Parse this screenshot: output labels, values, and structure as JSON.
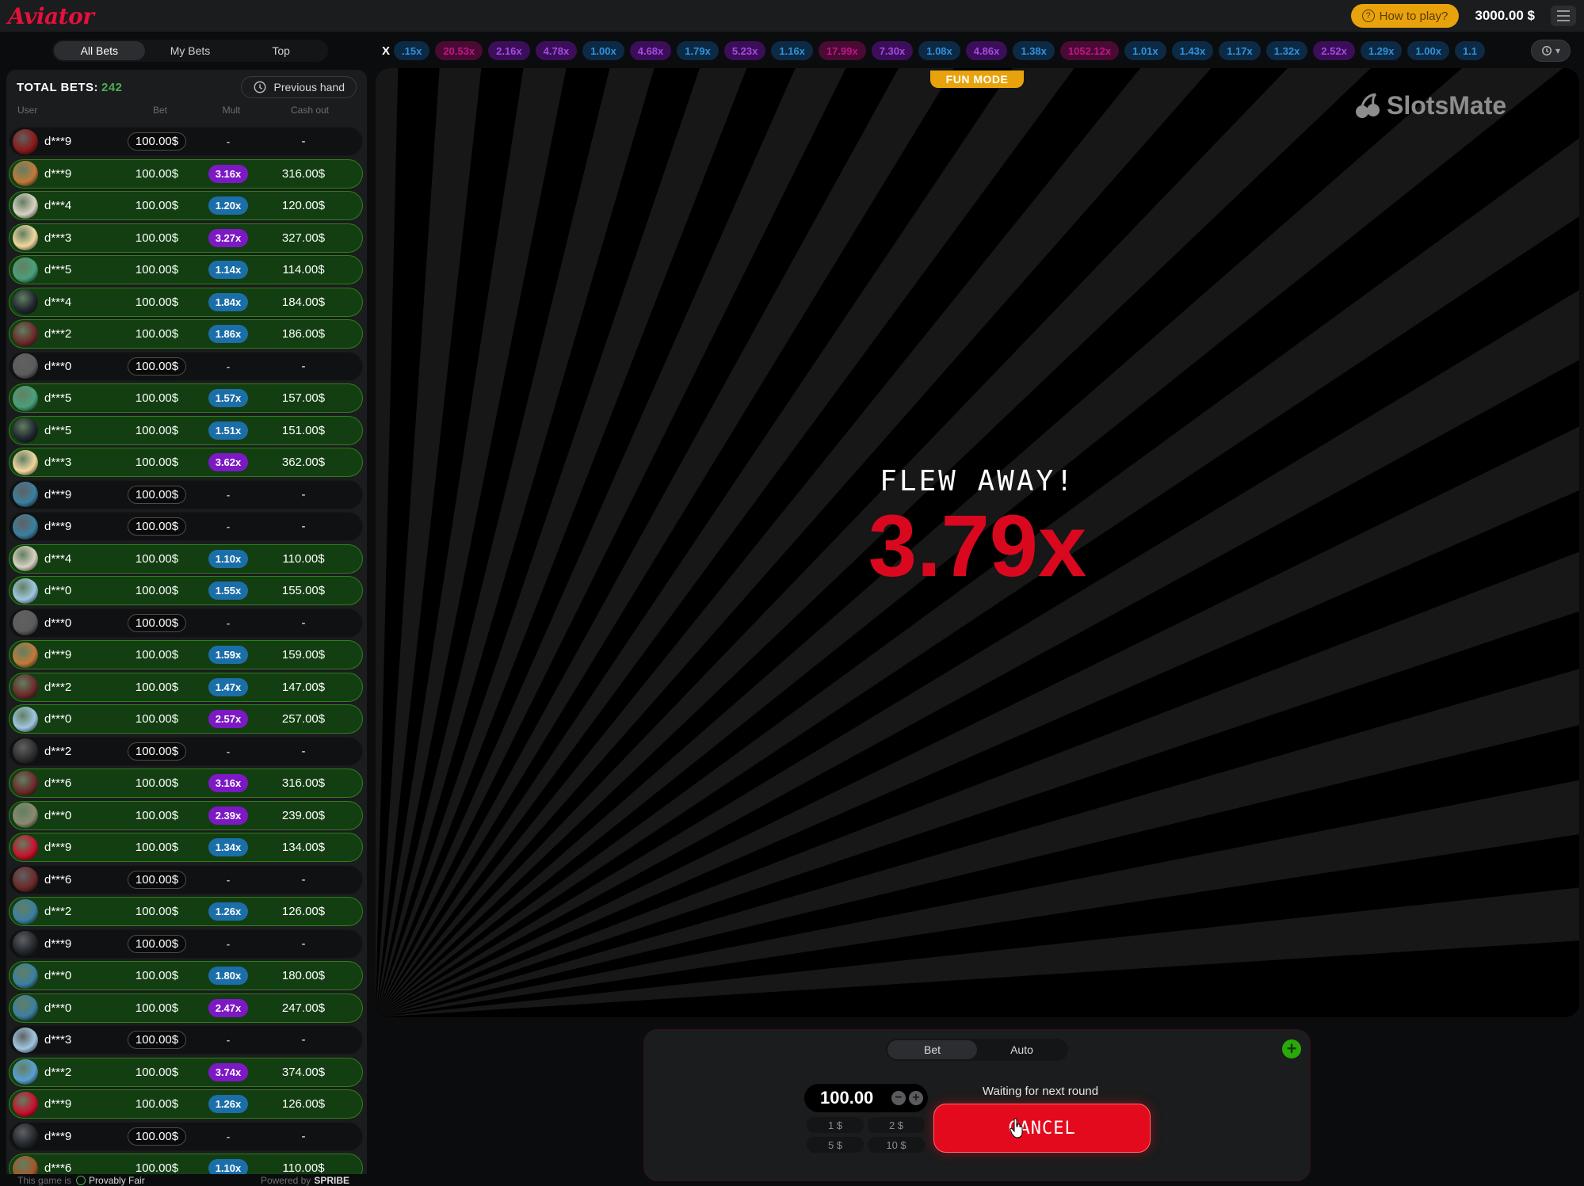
{
  "header": {
    "logo": "Aviator",
    "how_to_play": "How to play?",
    "balance": "3000.00 $"
  },
  "bets_panel": {
    "tabs": [
      "All Bets",
      "My Bets",
      "Top"
    ],
    "active_tab": "All Bets",
    "total_label": "TOTAL BETS:",
    "total_count": "242",
    "previous_hand": "Previous hand",
    "columns": {
      "user": "User",
      "bet": "Bet",
      "mult": "Mult",
      "cashout": "Cash out"
    },
    "rows": [
      {
        "user": "d***9",
        "bet": "100.00$",
        "mult": "-",
        "cashout": "-",
        "win": false,
        "avatar": "#8b1a1a"
      },
      {
        "user": "d***9",
        "bet": "100.00$",
        "mult": "3.16x",
        "cashout": "316.00$",
        "win": true,
        "avatar": "#c07a3a"
      },
      {
        "user": "d***4",
        "bet": "100.00$",
        "mult": "1.20x",
        "cashout": "120.00$",
        "win": true,
        "avatar": "#d9d2c2"
      },
      {
        "user": "d***3",
        "bet": "100.00$",
        "mult": "3.27x",
        "cashout": "327.00$",
        "win": true,
        "avatar": "#f1d7a0"
      },
      {
        "user": "d***5",
        "bet": "100.00$",
        "mult": "1.14x",
        "cashout": "114.00$",
        "win": true,
        "avatar": "#4aa07a"
      },
      {
        "user": "d***4",
        "bet": "100.00$",
        "mult": "1.84x",
        "cashout": "184.00$",
        "win": true,
        "avatar": "#20262e"
      },
      {
        "user": "d***2",
        "bet": "100.00$",
        "mult": "1.86x",
        "cashout": "186.00$",
        "win": true,
        "avatar": "#6b2a2a"
      },
      {
        "user": "d***0",
        "bet": "100.00$",
        "mult": "-",
        "cashout": "-",
        "win": false,
        "avatar": "#5c5c5c"
      },
      {
        "user": "d***5",
        "bet": "100.00$",
        "mult": "1.57x",
        "cashout": "157.00$",
        "win": true,
        "avatar": "#4aa07a"
      },
      {
        "user": "d***5",
        "bet": "100.00$",
        "mult": "1.51x",
        "cashout": "151.00$",
        "win": true,
        "avatar": "#20262e"
      },
      {
        "user": "d***3",
        "bet": "100.00$",
        "mult": "3.62x",
        "cashout": "362.00$",
        "win": true,
        "avatar": "#f1d7a0"
      },
      {
        "user": "d***9",
        "bet": "100.00$",
        "mult": "-",
        "cashout": "-",
        "win": false,
        "avatar": "#3c7fa0"
      },
      {
        "user": "d***9",
        "bet": "100.00$",
        "mult": "-",
        "cashout": "-",
        "win": false,
        "avatar": "#3c7fa0"
      },
      {
        "user": "d***4",
        "bet": "100.00$",
        "mult": "1.10x",
        "cashout": "110.00$",
        "win": true,
        "avatar": "#d9d2c2"
      },
      {
        "user": "d***0",
        "bet": "100.00$",
        "mult": "1.55x",
        "cashout": "155.00$",
        "win": true,
        "avatar": "#9fc6e0"
      },
      {
        "user": "d***0",
        "bet": "100.00$",
        "mult": "-",
        "cashout": "-",
        "win": false,
        "avatar": "#5c5c5c"
      },
      {
        "user": "d***9",
        "bet": "100.00$",
        "mult": "1.59x",
        "cashout": "159.00$",
        "win": true,
        "avatar": "#c07a3a"
      },
      {
        "user": "d***2",
        "bet": "100.00$",
        "mult": "1.47x",
        "cashout": "147.00$",
        "win": true,
        "avatar": "#6b2a2a"
      },
      {
        "user": "d***0",
        "bet": "100.00$",
        "mult": "2.57x",
        "cashout": "257.00$",
        "win": true,
        "avatar": "#9fc6e0"
      },
      {
        "user": "d***2",
        "bet": "100.00$",
        "mult": "-",
        "cashout": "-",
        "win": false,
        "avatar": "#2e2e2e"
      },
      {
        "user": "d***6",
        "bet": "100.00$",
        "mult": "3.16x",
        "cashout": "316.00$",
        "win": true,
        "avatar": "#6b2a2a"
      },
      {
        "user": "d***0",
        "bet": "100.00$",
        "mult": "2.39x",
        "cashout": "239.00$",
        "win": true,
        "avatar": "#8a8a70"
      },
      {
        "user": "d***9",
        "bet": "100.00$",
        "mult": "1.34x",
        "cashout": "134.00$",
        "win": true,
        "avatar": "#c8102e"
      },
      {
        "user": "d***6",
        "bet": "100.00$",
        "mult": "-",
        "cashout": "-",
        "win": false,
        "avatar": "#6b2a2a"
      },
      {
        "user": "d***2",
        "bet": "100.00$",
        "mult": "1.26x",
        "cashout": "126.00$",
        "win": true,
        "avatar": "#3c7fa0"
      },
      {
        "user": "d***9",
        "bet": "100.00$",
        "mult": "-",
        "cashout": "-",
        "win": false,
        "avatar": "#22272d"
      },
      {
        "user": "d***0",
        "bet": "100.00$",
        "mult": "1.80x",
        "cashout": "180.00$",
        "win": true,
        "avatar": "#3c7fa0"
      },
      {
        "user": "d***0",
        "bet": "100.00$",
        "mult": "2.47x",
        "cashout": "247.00$",
        "win": true,
        "avatar": "#3c7fa0"
      },
      {
        "user": "d***3",
        "bet": "100.00$",
        "mult": "-",
        "cashout": "-",
        "win": false,
        "avatar": "#9fc6e0"
      },
      {
        "user": "d***2",
        "bet": "100.00$",
        "mult": "3.74x",
        "cashout": "374.00$",
        "win": true,
        "avatar": "#5a9fd0"
      },
      {
        "user": "d***9",
        "bet": "100.00$",
        "mult": "1.26x",
        "cashout": "126.00$",
        "win": true,
        "avatar": "#c8102e"
      },
      {
        "user": "d***9",
        "bet": "100.00$",
        "mult": "-",
        "cashout": "-",
        "win": false,
        "avatar": "#22272d"
      },
      {
        "user": "d***6",
        "bet": "100.00$",
        "mult": "1.10x",
        "cashout": "110.00$",
        "win": true,
        "avatar": "#a0582a"
      }
    ]
  },
  "footer": {
    "game_is": "This game is",
    "provably_fair": "Provably Fair",
    "powered_by": "Powered by",
    "brand": "SPRIBE"
  },
  "history": {
    "lead_x": "X",
    "chips": [
      ".15x",
      "20.53x",
      "2.16x",
      "4.78x",
      "1.00x",
      "4.68x",
      "1.79x",
      "5.23x",
      "1.16x",
      "17.99x",
      "7.30x",
      "1.08x",
      "4.86x",
      "1.38x",
      "1052.12x",
      "1.01x",
      "1.43x",
      "1.17x",
      "1.32x",
      "2.52x",
      "1.29x",
      "1.00x",
      "1.1"
    ]
  },
  "game": {
    "fun_mode": "FUN MODE",
    "watermark": "SlotsMate",
    "flew_away": "FLEW AWAY!",
    "multiplier": "3.79x"
  },
  "bet_control": {
    "tabs": [
      "Bet",
      "Auto"
    ],
    "active_tab": "Bet",
    "amount": "100.00",
    "quick_amounts": [
      "1 $",
      "2 $",
      "5 $",
      "10 $"
    ],
    "status": "Waiting for next round",
    "cancel_label": "CANCEL"
  },
  "colors": {
    "brand": "#e5103b",
    "win_row": "#133e12",
    "mult_blue": "#1c6ea8",
    "mult_purple": "#7c19c4",
    "cancel": "#e30a1d",
    "flew_red": "#d9081f"
  }
}
